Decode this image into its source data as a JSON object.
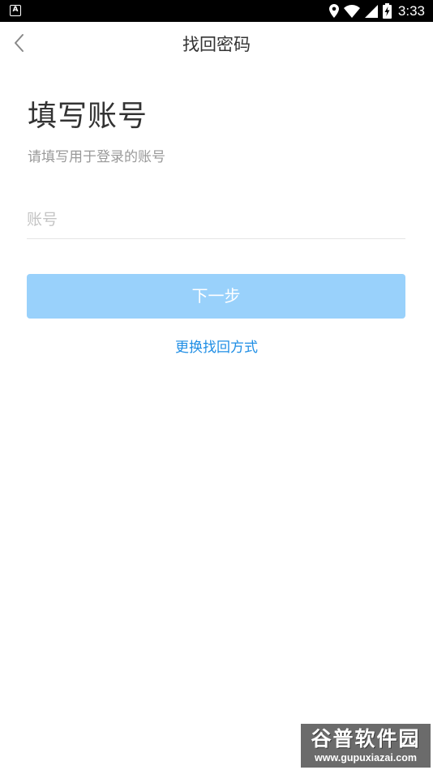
{
  "status_bar": {
    "time": "3:33",
    "app_icon_glyph": "A",
    "icons": [
      "location-icon",
      "wifi-icon",
      "signal-icon",
      "battery-charging-icon"
    ]
  },
  "nav": {
    "title": "找回密码",
    "back_icon": "chevron-left-icon"
  },
  "form": {
    "heading": "填写账号",
    "subtitle": "请填写用于登录的账号",
    "account_placeholder": "账号",
    "account_value": "",
    "next_label": "下一步",
    "switch_method_label": "更换找回方式"
  },
  "watermark": {
    "title": "谷普软件园",
    "url": "www.gupuxiazai.com"
  },
  "colors": {
    "primary_disabled": "#99d1fb",
    "link": "#1f8ee5",
    "heading": "#333333",
    "subtitle": "#999999",
    "placeholder": "#c4c4c4"
  }
}
